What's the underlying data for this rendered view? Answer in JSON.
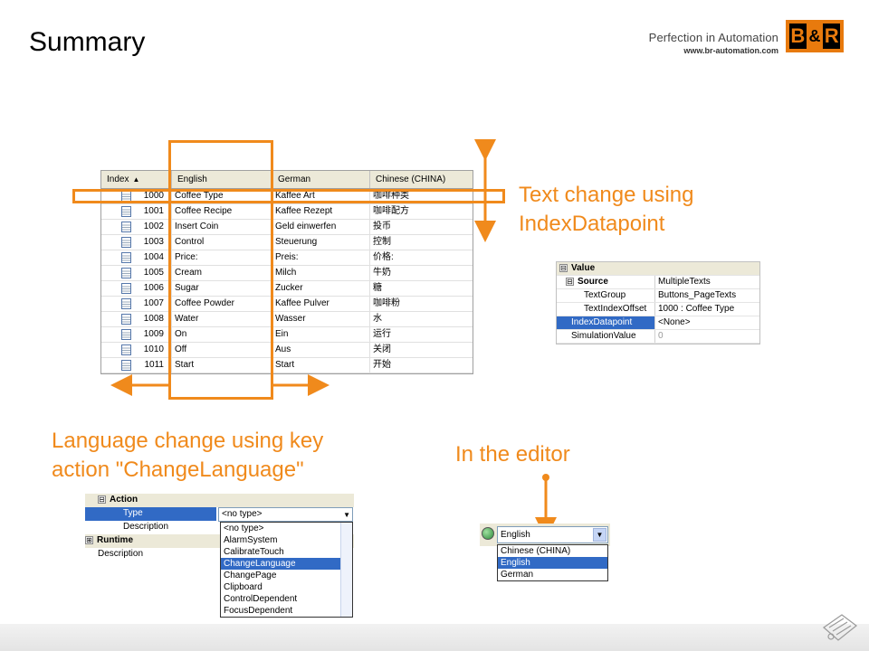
{
  "header": {
    "title": "Summary",
    "tagline": "Perfection in Automation",
    "website": "www.br-automation.com",
    "logo_text": [
      "B",
      "&",
      "R"
    ]
  },
  "colors": {
    "accent": "#f08a1c",
    "selection": "#316ac5",
    "brand_black": "#000000"
  },
  "text_table": {
    "headers": {
      "index": "Index",
      "english": "English",
      "german": "German",
      "chinese": "Chinese (CHINA)"
    },
    "rows": [
      {
        "index": "1000",
        "english": "Coffee Type",
        "german": "Kaffee Art",
        "chinese": "咖啡种类"
      },
      {
        "index": "1001",
        "english": "Coffee Recipe",
        "german": "Kaffee Rezept",
        "chinese": "咖啡配方"
      },
      {
        "index": "1002",
        "english": "Insert Coin",
        "german": "Geld einwerfen",
        "chinese": "投币"
      },
      {
        "index": "1003",
        "english": "Control",
        "german": "Steuerung",
        "chinese": "控制"
      },
      {
        "index": "1004",
        "english": "Price:",
        "german": "Preis:",
        "chinese": "价格:"
      },
      {
        "index": "1005",
        "english": "Cream",
        "german": "Milch",
        "chinese": "牛奶"
      },
      {
        "index": "1006",
        "english": "Sugar",
        "german": "Zucker",
        "chinese": "糖"
      },
      {
        "index": "1007",
        "english": "Coffee Powder",
        "german": "Kaffee Pulver",
        "chinese": "咖啡粉"
      },
      {
        "index": "1008",
        "english": "Water",
        "german": "Wasser",
        "chinese": "水"
      },
      {
        "index": "1009",
        "english": "On",
        "german": "Ein",
        "chinese": "运行"
      },
      {
        "index": "1010",
        "english": "Off",
        "german": "Aus",
        "chinese": "关闭"
      },
      {
        "index": "1011",
        "english": "Start",
        "german": "Start",
        "chinese": "开始"
      }
    ]
  },
  "labels": {
    "text_change": [
      "Text change using",
      "IndexDatapoint"
    ],
    "language_change": [
      "Language change using key",
      "action \"ChangeLanguage\""
    ],
    "in_editor": "In the editor"
  },
  "value_props": {
    "category": "Value",
    "source_label": "Source",
    "source_value": "MultipleTexts",
    "textgroup_label": "TextGroup",
    "textgroup_value": "Buttons_PageTexts",
    "offset_label": "TextIndexOffset",
    "offset_value": "1000 : Coffee Type",
    "indexdp_label": "IndexDatapoint",
    "indexdp_value": "<None>",
    "sim_label": "SimulationValue",
    "sim_value": "0",
    "toggle_minus": "⊟"
  },
  "action_panel": {
    "action_category": "Action",
    "type_label": "Type",
    "type_value": "<no type>",
    "description_label": "Description",
    "runtime_category": "Runtime",
    "runtime_description_label": "Description",
    "toggle_minus": "⊟",
    "toggle_plus": "⊞",
    "dropdown_options": [
      "<no type>",
      "AlarmSystem",
      "CalibrateTouch",
      "ChangeLanguage",
      "ChangePage",
      "Clipboard",
      "ControlDependent",
      "FocusDependent"
    ],
    "highlighted": "ChangeLanguage"
  },
  "language_selector": {
    "current": "English",
    "options": [
      "Chinese (CHINA)",
      "English",
      "German"
    ],
    "highlighted": "English"
  }
}
